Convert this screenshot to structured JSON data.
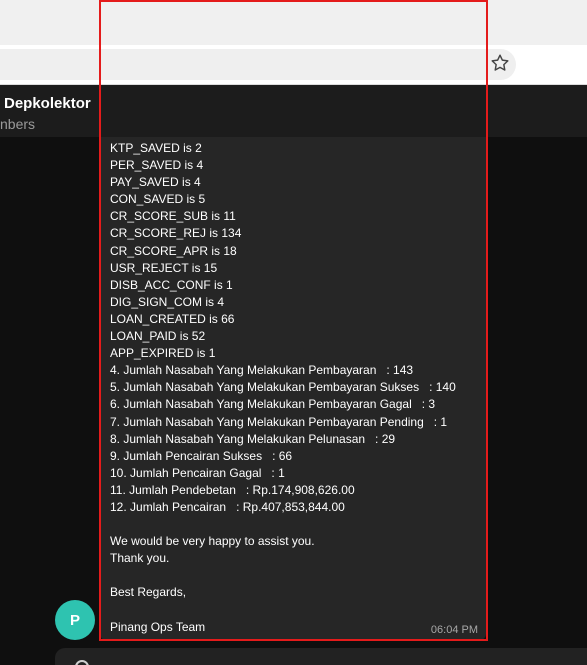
{
  "chat": {
    "group_name": "Depkolektor",
    "members_text": "nbers"
  },
  "avatar": {
    "initial": "P",
    "color": "#2ec3b0"
  },
  "message": {
    "time": "06:04 PM",
    "lines": [
      "KTP_SAVED is 2",
      "PER_SAVED is 4",
      "PAY_SAVED is 4",
      "CON_SAVED is 5",
      "CR_SCORE_SUB is 11",
      "CR_SCORE_REJ is 134",
      "CR_SCORE_APR is 18",
      "USR_REJECT is 15",
      "DISB_ACC_CONF is 1",
      "DIG_SIGN_COM is 4",
      "LOAN_CREATED is 66",
      "LOAN_PAID is 52",
      "APP_EXPIRED is 1",
      "4. Jumlah Nasabah Yang Melakukan Pembayaran   : 143",
      "5. Jumlah Nasabah Yang Melakukan Pembayaran Sukses   : 140",
      "6. Jumlah Nasabah Yang Melakukan Pembayaran Gagal   : 3",
      "7. Jumlah Nasabah Yang Melakukan Pembayaran Pending   : 1",
      "8. Jumlah Nasabah Yang Melakukan Pelunasan   : 29",
      "9. Jumlah Pencairan Sukses   : 66",
      "10. Jumlah Pencairan Gagal   : 1",
      "11. Jumlah Pendebetan   : Rp.174,908,626.00",
      "12. Jumlah Pencairan   : Rp.407,853,844.00",
      "",
      "We would be very happy to assist you.",
      "Thank you.",
      "",
      "Best Regards,",
      "",
      "Pinang Ops Team"
    ]
  },
  "colors": {
    "background": "#0f0f0f",
    "bubble": "#262626",
    "highlight": "#e41b1b"
  }
}
